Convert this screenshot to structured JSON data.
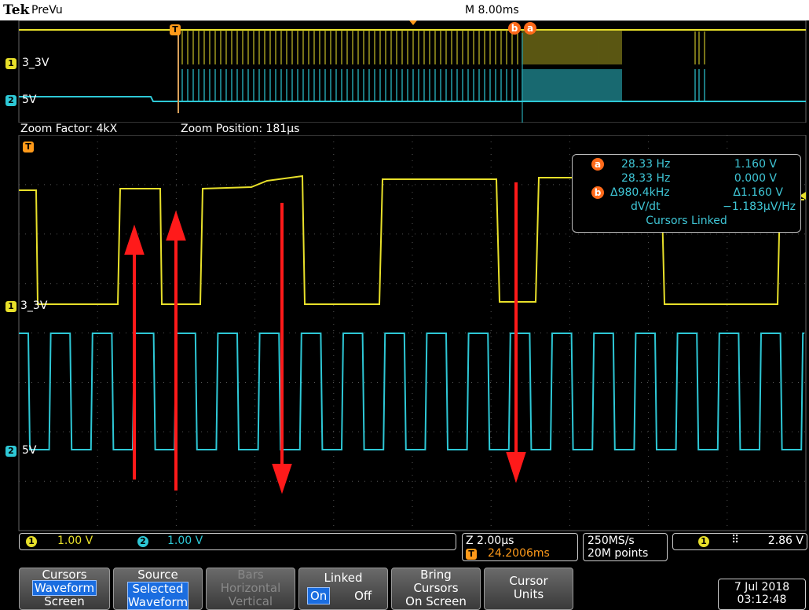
{
  "header": {
    "brand": "Tek",
    "mode": "PreVu",
    "timebase": "M 8.00ms"
  },
  "overview": {
    "ch1_label": "3_3V",
    "ch2_label": "5V"
  },
  "zoom": {
    "factor": "Zoom Factor: 4kX",
    "position": "Zoom Position: 181μs"
  },
  "main": {
    "ch1_label": "3_3V",
    "ch2_label": "5V"
  },
  "channels": {
    "ch1_num": "1",
    "ch2_num": "2",
    "trigger_mark": "T",
    "cursor_a": "a",
    "cursor_b": "b"
  },
  "cursor_readout": {
    "a_freq": "28.33 Hz",
    "a_volt": "1.160 V",
    "b_freq": "28.33 Hz",
    "b_volt": "0.000 V",
    "delta_freq": "Δ980.4kHz",
    "delta_volt": "Δ1.160 V",
    "dvdt_label": "dV/dt",
    "dvdt_value": "−1.183μV/Hz",
    "linked": "Cursors Linked"
  },
  "status": {
    "ch1_scale": "1.00 V",
    "ch2_scale": "1.00 V",
    "zoom_scale": "Z 2.00μs",
    "trigger_pos": "24.2006ms",
    "sample_rate": "250MS/s",
    "points": "20M points",
    "trig_level": "2.86 V"
  },
  "buttons": {
    "cursors": {
      "title": "Cursors",
      "sel": "Waveform",
      "other": "Screen"
    },
    "source": {
      "title": "Source",
      "sel1": "Selected",
      "sel2": "Waveform"
    },
    "bars": {
      "title": "Bars",
      "l2": "Horizontal",
      "l3": "Vertical"
    },
    "linked": {
      "title": "Linked",
      "on": "On",
      "off": "Off"
    },
    "bring": {
      "l1": "Bring",
      "l2": "Cursors",
      "l3": "On Screen"
    },
    "units": {
      "l1": "Cursor",
      "l2": "Units"
    }
  },
  "datetime": {
    "date": "7 Jul  2018",
    "time": "03:12:48"
  },
  "colors": {
    "ch1": "#e8e02a",
    "ch2": "#2ec8d6",
    "annotation": "#ff0000",
    "cursor": "#ff6a1a"
  }
}
